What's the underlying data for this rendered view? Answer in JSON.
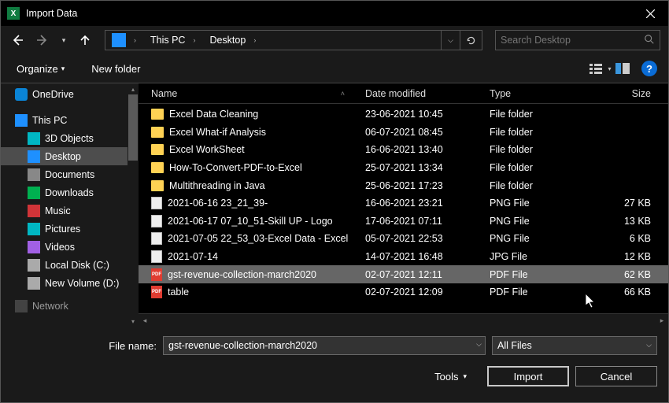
{
  "title": "Import Data",
  "breadcrumb": {
    "root": "This PC",
    "leaf": "Desktop"
  },
  "search": {
    "placeholder": "Search Desktop"
  },
  "toolbar": {
    "organize": "Organize",
    "newfolder": "New folder"
  },
  "sidebar": {
    "onedrive": "OneDrive",
    "thispc": "This PC",
    "items": [
      {
        "label": "3D Objects"
      },
      {
        "label": "Desktop"
      },
      {
        "label": "Documents"
      },
      {
        "label": "Downloads"
      },
      {
        "label": "Music"
      },
      {
        "label": "Pictures"
      },
      {
        "label": "Videos"
      },
      {
        "label": "Local Disk (C:)"
      },
      {
        "label": "New Volume (D:)"
      }
    ],
    "network": "Network"
  },
  "columns": {
    "name": "Name",
    "date": "Date modified",
    "type": "Type",
    "size": "Size"
  },
  "files": [
    {
      "name": "Excel Data Cleaning",
      "date": "23-06-2021 10:45",
      "type": "File folder",
      "size": "",
      "kind": "folder"
    },
    {
      "name": "Excel What-if Analysis",
      "date": "06-07-2021 08:45",
      "type": "File folder",
      "size": "",
      "kind": "folder"
    },
    {
      "name": "Excel WorkSheet",
      "date": "16-06-2021 13:40",
      "type": "File folder",
      "size": "",
      "kind": "folder"
    },
    {
      "name": "How-To-Convert-PDF-to-Excel",
      "date": "25-07-2021 13:34",
      "type": "File folder",
      "size": "",
      "kind": "folder"
    },
    {
      "name": "Multithreading in Java",
      "date": "25-06-2021 17:23",
      "type": "File folder",
      "size": "",
      "kind": "folder"
    },
    {
      "name": "2021-06-16 23_21_39-",
      "date": "16-06-2021 23:21",
      "type": "PNG File",
      "size": "27 KB",
      "kind": "file"
    },
    {
      "name": "2021-06-17 07_10_51-Skill UP - Logo",
      "date": "17-06-2021 07:11",
      "type": "PNG File",
      "size": "13 KB",
      "kind": "file"
    },
    {
      "name": "2021-07-05 22_53_03-Excel Data - Excel",
      "date": "05-07-2021 22:53",
      "type": "PNG File",
      "size": "6 KB",
      "kind": "file"
    },
    {
      "name": "2021-07-14",
      "date": "14-07-2021 16:48",
      "type": "JPG File",
      "size": "12 KB",
      "kind": "file"
    },
    {
      "name": "gst-revenue-collection-march2020",
      "date": "02-07-2021 12:11",
      "type": "PDF File",
      "size": "62 KB",
      "kind": "pdf",
      "selected": true
    },
    {
      "name": "table",
      "date": "02-07-2021 12:09",
      "type": "PDF File",
      "size": "66 KB",
      "kind": "pdf"
    }
  ],
  "bottom": {
    "label": "File name:",
    "value": "gst-revenue-collection-march2020",
    "filter": "All Files",
    "tools": "Tools",
    "import": "Import",
    "cancel": "Cancel"
  },
  "help": "?"
}
